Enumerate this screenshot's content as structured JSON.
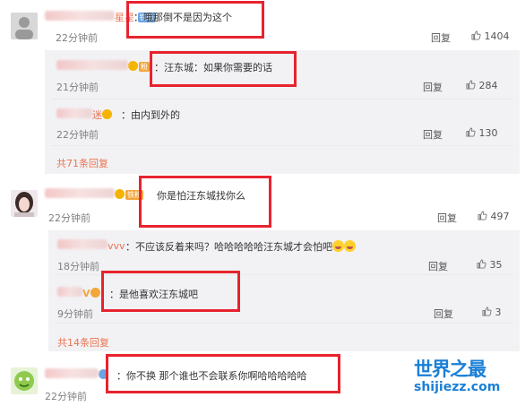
{
  "actions": {
    "reply": "回复"
  },
  "comments": [
    {
      "name_visible": "星星",
      "badge": "铁粉",
      "text": "：哦那倒不是因为这个",
      "time": "22分钟前",
      "likes": "1404"
    },
    {
      "badge": "铁粉",
      "text": "你是怕汪东城找你么",
      "time": "22分钟前",
      "likes": "497"
    },
    {
      "text": "：你不换 那个谁也不会联系你啊哈哈哈哈哈",
      "time": "22分钟前"
    }
  ],
  "replies_group1": [
    {
      "text": "：汪东城：如果你需要的话",
      "time": "21分钟前",
      "likes": "284"
    },
    {
      "name_visible": "迷",
      "text": "：由内到外的",
      "time": "22分钟前",
      "likes": "130"
    }
  ],
  "replies_group2": [
    {
      "name_visible": "vvv",
      "text": "：不应该反着来吗？哈哈哈哈哈汪东城才会怕吧",
      "time": "18分钟前",
      "likes": "35"
    },
    {
      "name_visible": "V",
      "text": "：是他喜欢汪东城吧",
      "time": "9分钟前",
      "likes": "3"
    }
  ],
  "more_group1": "共71条回复",
  "more_group2": "共14条回复",
  "watermark": {
    "title": "世界之最",
    "url": "shijiezz.com"
  },
  "colors": {
    "highlight_box": "#e8232e",
    "link_orange": "#eb7350",
    "watermark_blue": "#1a7fd6"
  }
}
